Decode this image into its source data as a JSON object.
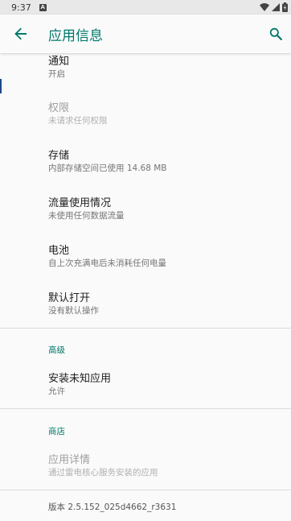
{
  "status_bar": {
    "time": "9:37",
    "notification_glyph": "A"
  },
  "app_bar": {
    "title": "应用信息",
    "title_color": "#00796b"
  },
  "preferences": [
    {
      "title": "通知",
      "summary": "开启",
      "enabled": true
    },
    {
      "title": "权限",
      "summary": "未请求任何权限",
      "enabled": false
    },
    {
      "title": "存储",
      "summary": "内部存储空间已使用 14.68 MB",
      "enabled": true
    },
    {
      "title": "流量使用情况",
      "summary": "未使用任何数据流量",
      "enabled": true
    },
    {
      "title": "电池",
      "summary": "自上次充满电后未消耗任何电量",
      "enabled": true
    },
    {
      "title": "默认打开",
      "summary": "没有默认操作",
      "enabled": true
    }
  ],
  "advanced": {
    "header": "高级",
    "items": [
      {
        "title": "安装未知应用",
        "summary": "允许",
        "enabled": true
      }
    ]
  },
  "store": {
    "header": "商店",
    "items": [
      {
        "title": "应用详情",
        "summary": "通过雷电核心服务安装的应用",
        "enabled": false
      }
    ]
  },
  "footer": {
    "version": "版本 2.5.152_025d4662_r3631"
  }
}
